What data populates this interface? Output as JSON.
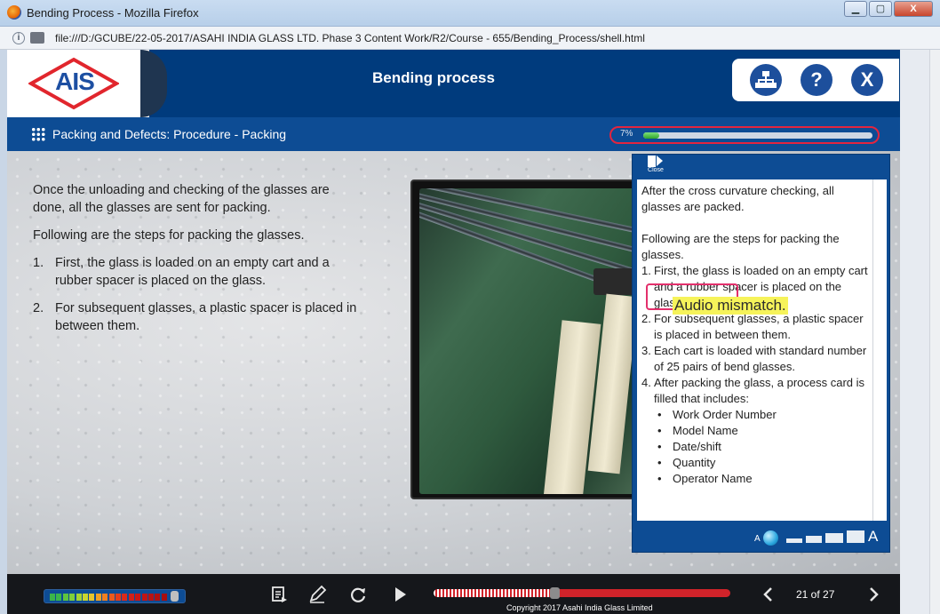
{
  "browser": {
    "window_title": "Bending Process - Mozilla Firefox",
    "url": "file:///D:/GCUBE/22-05-2017/ASAHI INDIA GLASS LTD. Phase 3 Content Work/R2/Course - 655/Bending_Process/shell.html",
    "controls": {
      "minimize": "▁",
      "maximize": "▢",
      "close": "X"
    }
  },
  "header": {
    "logo_text": "AIS",
    "course_title": "Bending process",
    "buttons": [
      {
        "name": "sitemap",
        "icon": "sitemap-icon"
      },
      {
        "name": "help",
        "label": "?"
      },
      {
        "name": "exit",
        "label": "X"
      }
    ]
  },
  "subheader": {
    "page_heading": "Packing and Defects: Procedure - Packing",
    "progress_label": "7%",
    "progress_value": 0.07
  },
  "content": {
    "intro": "Once the unloading and checking of the glasses are done, all the glasses are sent for packing.",
    "lead": "Following are the steps for packing the glasses.",
    "steps": [
      {
        "num": "1.",
        "text": "First, the glass is loaded on an empty cart and a rubber spacer is placed on the glass."
      },
      {
        "num": "2.",
        "text": "For subsequent glasses, a plastic spacer is placed in between them."
      }
    ]
  },
  "transcript": {
    "close_label": "Close",
    "para1": "After the cross curvature checking, all glasses are packed.",
    "para2": "Following are the steps for packing the glasses.",
    "items": [
      {
        "num": "1.",
        "text": "First, the glass is loaded on an empty cart and a rubber spacer is placed on the glass."
      },
      {
        "num": "2.",
        "text": "For subsequent glasses, a plastic spacer is placed in between them."
      },
      {
        "num": "3.",
        "text": "Each cart is loaded with standard number of 25 pairs of bend glasses."
      },
      {
        "num": "4.",
        "text": "After packing the glass, a process card is filled that includes:"
      }
    ],
    "bullets": [
      "Work Order Number",
      "Model Name",
      "Date/shift",
      "Quantity",
      "Operator Name"
    ],
    "annotation": "Audio mismatch.",
    "font_small": "A",
    "font_large": "A"
  },
  "footer": {
    "page_count": "21 of 27",
    "copyright": "Copyright 2017 Asahi India Glass Limited",
    "seek_progress": 0.41,
    "buttons": [
      "transcript-icon",
      "notes-icon",
      "replay-icon",
      "play-icon",
      "prev-icon",
      "next-icon"
    ]
  },
  "colors": {
    "brand_blue": "#003b7d",
    "accent_red": "#e3253f",
    "highlight_yellow": "#f6f35a"
  }
}
